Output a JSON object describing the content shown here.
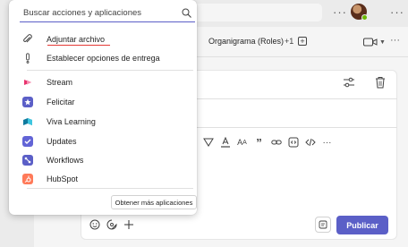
{
  "header": {
    "tab_orgchart": "Organigrama (Roles)",
    "tab_overflow": "+1",
    "add_tab": "+",
    "header_more": "···",
    "top_more": "···"
  },
  "popup": {
    "search_placeholder": "Buscar acciones y aplicaciones",
    "actions": [
      {
        "label": "Adjuntar archivo",
        "icon": "paperclip-icon"
      },
      {
        "label": "Establecer opciones de entrega",
        "icon": "exclamation-icon"
      }
    ],
    "apps": [
      {
        "label": "Stream",
        "icon": "stream-icon",
        "color": "#e8336d"
      },
      {
        "label": "Felicitar",
        "icon": "praise-icon",
        "color": "#5b5fc7"
      },
      {
        "label": "Viva Learning",
        "icon": "viva-learning-icon",
        "color": "#0f7a9e"
      },
      {
        "label": "Updates",
        "icon": "updates-icon",
        "color": "#6264d6"
      },
      {
        "label": "Workflows",
        "icon": "workflows-icon",
        "color": "#5b5fc7"
      },
      {
        "label": "HubSpot",
        "icon": "hubspot-icon",
        "color": "#ff7a59"
      }
    ],
    "more_apps_label": "Obtener más aplicaciones"
  },
  "compose": {
    "publish_label": "Publicar"
  },
  "colors": {
    "accent": "#5b5fc7",
    "background": "#ebebeb",
    "surface": "#ffffff"
  }
}
